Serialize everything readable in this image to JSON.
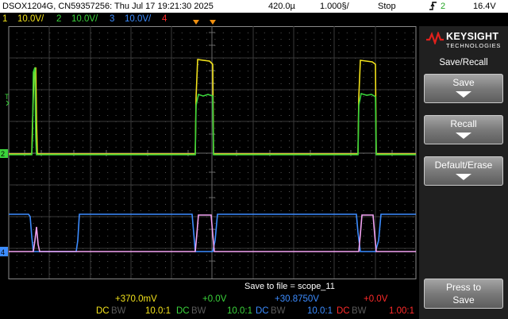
{
  "header": {
    "device_info": "DSOX1204G, CN59357256: Thu Jul 17 19:21:30 2025",
    "timebase_delay": "420.0µ",
    "timebase_scale": "1.000§/",
    "run_state": "Stop",
    "trigger_channel": "2",
    "trigger_level": "16.4V"
  },
  "channels": [
    {
      "num": "1",
      "scale": "10.0V/",
      "color": "#f2e21b"
    },
    {
      "num": "2",
      "scale": "10.0V/",
      "color": "#3bd43b"
    },
    {
      "num": "3",
      "scale": "10.0V/",
      "color": "#3c8cff"
    },
    {
      "num": "4",
      "scale": "",
      "color": "#ff2a2a"
    }
  ],
  "save_status": "Save to file = scope_11",
  "offsets": [
    {
      "value": "+370.0mV",
      "coupling": "DC",
      "bw": "BW",
      "probe": "10.0:1",
      "color": "#f2e21b"
    },
    {
      "value": "+0.0V",
      "coupling": "DC",
      "bw": "BW",
      "probe": "10.0:1",
      "color": "#3bd43b"
    },
    {
      "value": "+30.8750V",
      "coupling": "DC",
      "bw": "BW",
      "probe": "10.0:1",
      "color": "#3c8cff"
    },
    {
      "value": "+0.0V",
      "coupling": "DC",
      "bw": "BW",
      "probe": "1.00:1",
      "color": "#ff2a2a"
    }
  ],
  "brand": {
    "name": "KEYSIGHT",
    "sub": "TECHNOLOGIES"
  },
  "menu": {
    "title": "Save/Recall",
    "keys": [
      "Save",
      "Recall",
      "Default/Erase"
    ],
    "press_to_save": [
      "Press to",
      "Save"
    ]
  },
  "markers": {
    "ch1": "1",
    "ch2_ref": "2",
    "ch3": "3",
    "ch4": "4",
    "trig": "T"
  }
}
